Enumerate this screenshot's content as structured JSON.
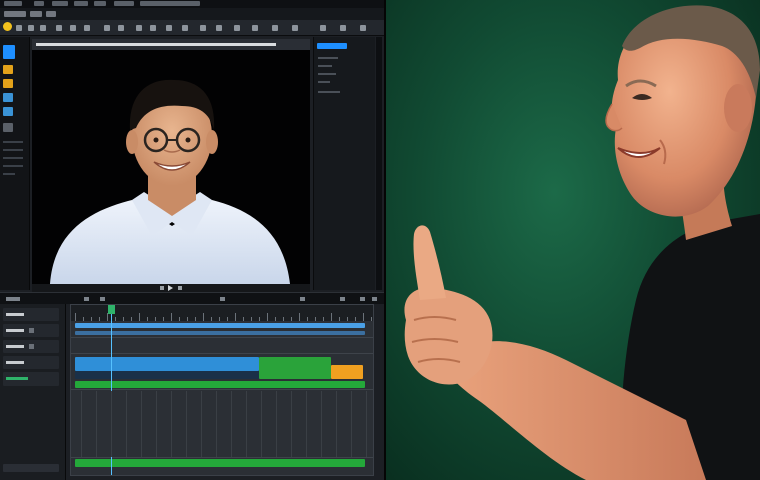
{
  "window": {
    "app": "video-editor",
    "layout": [
      "tools-panel",
      "preview-viewer",
      "inspector",
      "timeline"
    ]
  },
  "colors": {
    "accent_blue": "#1e8fff",
    "logo_yellow": "#f3c21d",
    "video_clip": "#2f8fd8",
    "audio_clip": "#2aa33a",
    "title_clip": "#f0a020",
    "backdrop_green": "#114b33"
  },
  "icons": {
    "logo": "app-logo-icon",
    "play": "play-icon",
    "cursor": "pointer-icon"
  },
  "preview": {
    "content": "interview-subject"
  }
}
